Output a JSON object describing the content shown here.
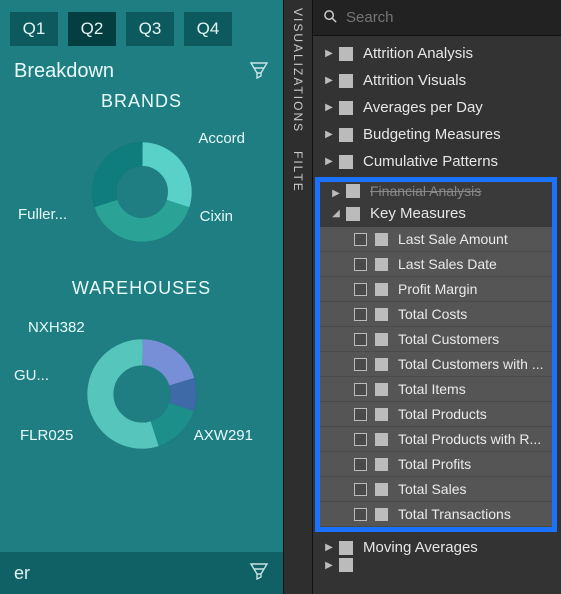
{
  "report": {
    "quarters": [
      "Q1",
      "Q2",
      "Q3",
      "Q4"
    ],
    "active_quarter_index": 1,
    "breakdown_label": "Breakdown",
    "bottom_label": "er",
    "brands_chart_title": "BRANDS",
    "warehouses_chart_title": "WAREHOUSES",
    "brands": {
      "labels": {
        "top_right": "Accord",
        "bottom_right": "Cixin",
        "bottom_left": "Fuller..."
      }
    },
    "warehouses": {
      "labels": {
        "top_left": "NXH382",
        "mid_left": "GU...",
        "bottom_left": "FLR025",
        "bottom_right": "AXW291"
      }
    }
  },
  "chart_data": [
    {
      "type": "pie",
      "title": "BRANDS",
      "series": [
        {
          "name": "Accord",
          "value": 30
        },
        {
          "name": "Cixin",
          "value": 40
        },
        {
          "name": "Fuller...",
          "value": 30
        }
      ]
    },
    {
      "type": "pie",
      "title": "WAREHOUSES",
      "series": [
        {
          "name": "NXH382",
          "value": 20
        },
        {
          "name": "GU...",
          "value": 10
        },
        {
          "name": "FLR025",
          "value": 15
        },
        {
          "name": "AXW291",
          "value": 55
        }
      ]
    }
  ],
  "side_tabs": {
    "visualizations": "VISUALIZATIONS",
    "filters": "FILTE"
  },
  "search": {
    "placeholder": "Search"
  },
  "tables_before": [
    "Attrition Analysis",
    "Attrition Visuals",
    "Averages per Day",
    "Budgeting Measures",
    "Cumulative Patterns"
  ],
  "highlighted": {
    "cut_table": "Financial Analysis",
    "expanded_table": "Key Measures",
    "measures": [
      "Last Sale Amount",
      "Last Sales Date",
      "Profit Margin",
      "Total Costs",
      "Total Customers",
      "Total Customers with ...",
      "Total Items",
      "Total Products",
      "Total Products with R...",
      "Total Profits",
      "Total Sales",
      "Total Transactions"
    ]
  },
  "tables_after": [
    "Moving Averages"
  ],
  "partial_after": ""
}
